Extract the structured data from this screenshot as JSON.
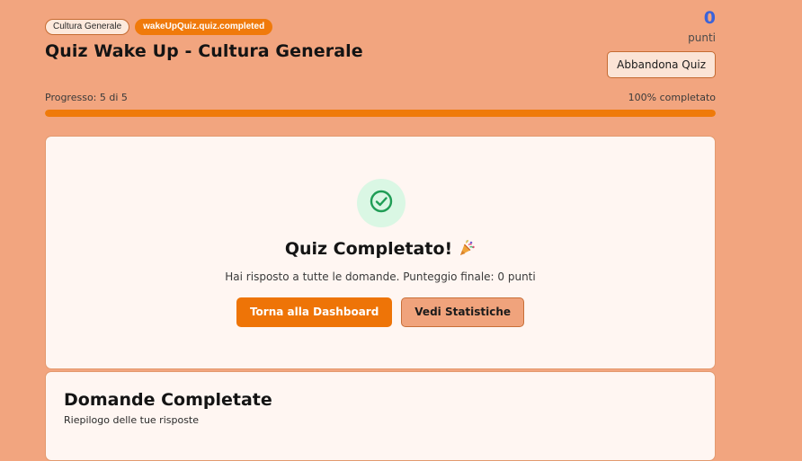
{
  "header": {
    "category_badge": "Cultura Generale",
    "status_badge": "wakeUpQuiz.quiz.completed",
    "title": "Quiz Wake Up - Cultura Generale",
    "score_value": "0",
    "score_label": "punti",
    "abandon_label": "Abbandona Quiz"
  },
  "progress": {
    "label": "Progresso: 5 di 5",
    "percent_label": "100% completato",
    "fraction": 1.0
  },
  "completion": {
    "title": "Quiz Completato!",
    "message": "Hai risposto a tutte le domande. Punteggio finale: 0 punti",
    "dashboard_button": "Torna alla Dashboard",
    "stats_button": "Vedi Statistiche",
    "icon": "check-circle-icon"
  },
  "questions": {
    "title": "Domande Completate",
    "subtitle": "Riepilogo delle tue risposte"
  },
  "colors": {
    "background": "#f2a57f",
    "accent": "#ee7407",
    "score": "#3b63d9",
    "success": "#1f9d55"
  }
}
